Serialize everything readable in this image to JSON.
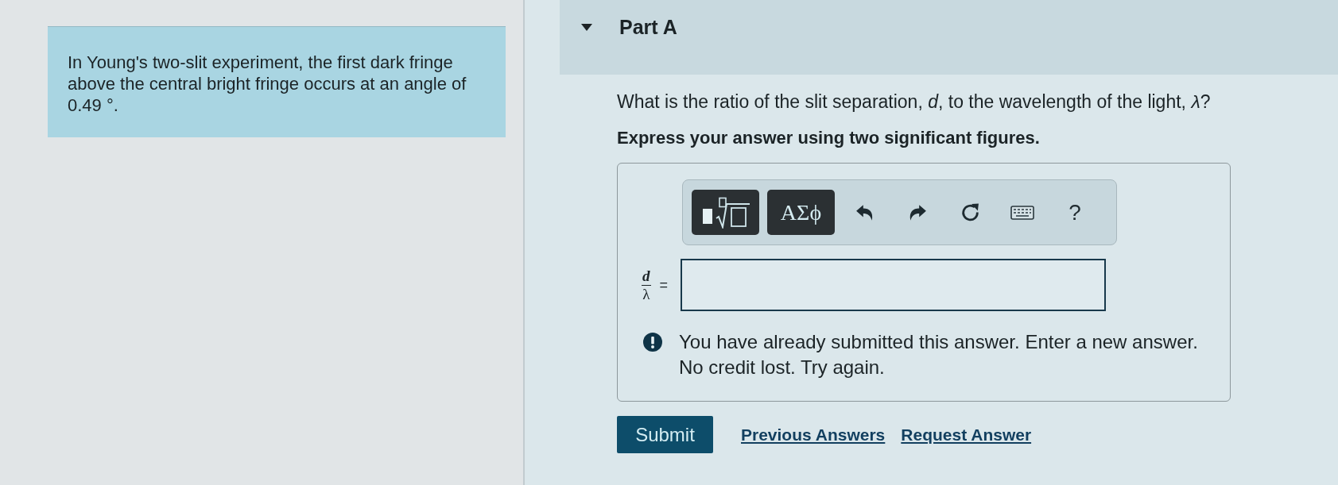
{
  "problem": {
    "text": "In Young's two-slit experiment, the first dark fringe above the central bright fringe occurs at an angle of 0.49 °."
  },
  "part": {
    "title": "Part A",
    "expanded": true
  },
  "question": {
    "text": "What is the ratio of the slit separation, *d*, to the wavelength of the light, *λ*?",
    "instruction": "Express your answer using two significant figures."
  },
  "toolbar": {
    "buttons": [
      {
        "kind": "templates"
      },
      {
        "kind": "symbols",
        "label": "ΑΣϕ"
      },
      {
        "kind": "undo"
      },
      {
        "kind": "redo"
      },
      {
        "kind": "reset"
      },
      {
        "kind": "keyboard"
      },
      {
        "kind": "help",
        "label": "?"
      }
    ]
  },
  "answer": {
    "numerator": "d",
    "denominator": "λ",
    "equals": "="
  },
  "feedback": {
    "kind": "warning",
    "text": "You have already submitted this answer. Enter a new answer. No credit lost. Try again."
  },
  "actions": {
    "submit": "Submit",
    "links": [
      "Previous Answers",
      "Request Answer"
    ]
  }
}
